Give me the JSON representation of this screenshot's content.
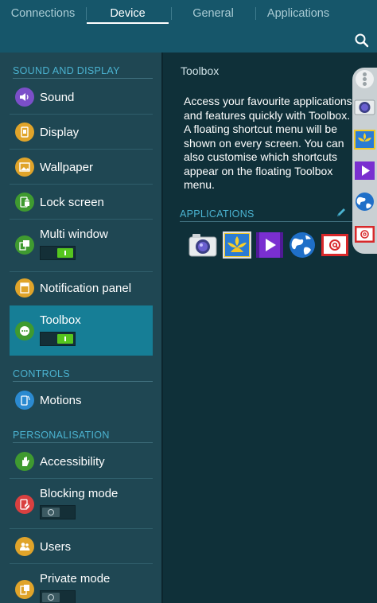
{
  "tabs": [
    {
      "label": "Connections",
      "active": false
    },
    {
      "label": "Device",
      "active": true
    },
    {
      "label": "General",
      "active": false
    },
    {
      "label": "Applications",
      "active": false
    }
  ],
  "sections": {
    "sound_display": "SOUND AND DISPLAY",
    "controls": "CONTROLS",
    "personalisation": "PERSONALISATION"
  },
  "items": {
    "sound": "Sound",
    "display": "Display",
    "wallpaper": "Wallpaper",
    "lock_screen": "Lock screen",
    "multi_window": "Multi window",
    "notification_panel": "Notification panel",
    "toolbox": "Toolbox",
    "motions": "Motions",
    "accessibility": "Accessibility",
    "blocking_mode": "Blocking mode",
    "users": "Users",
    "private_mode": "Private mode"
  },
  "switches": {
    "multi_window": "on",
    "toolbox": "on",
    "blocking_mode": "off",
    "private_mode": "off"
  },
  "selected_item": "toolbox",
  "detail": {
    "title": "Toolbox",
    "description": "Access your favourite applications and features quickly with Toolbox. A floating shortcut menu will be shown on every screen. You can also customise which shortcuts appear on the floating Toolbox menu.",
    "applications_header": "APPLICATIONS",
    "apps": [
      "camera-icon",
      "gallery-icon",
      "video-icon",
      "internet-icon",
      "email-icon"
    ]
  },
  "icons": {
    "search": "search-icon",
    "edit": "pencil-icon",
    "toolbox_menu": "dots-icon"
  },
  "colors": {
    "accent": "#4bb3d1",
    "selected_bg": "#167e96",
    "switch_on": "#55c51f",
    "topbar": "#16566a",
    "sound": "#7b4fc9",
    "display": "#e0a42a",
    "wallpaper": "#e0a42a",
    "lock_screen": "#3f9a30",
    "multi_window": "#3f9a30",
    "notification_panel": "#e0a42a",
    "toolbox": "#3f9a30",
    "motions": "#2b8ad0",
    "accessibility": "#3f9a30",
    "blocking_mode": "#d94040",
    "users": "#e0a42a",
    "private_mode": "#e0a42a"
  }
}
